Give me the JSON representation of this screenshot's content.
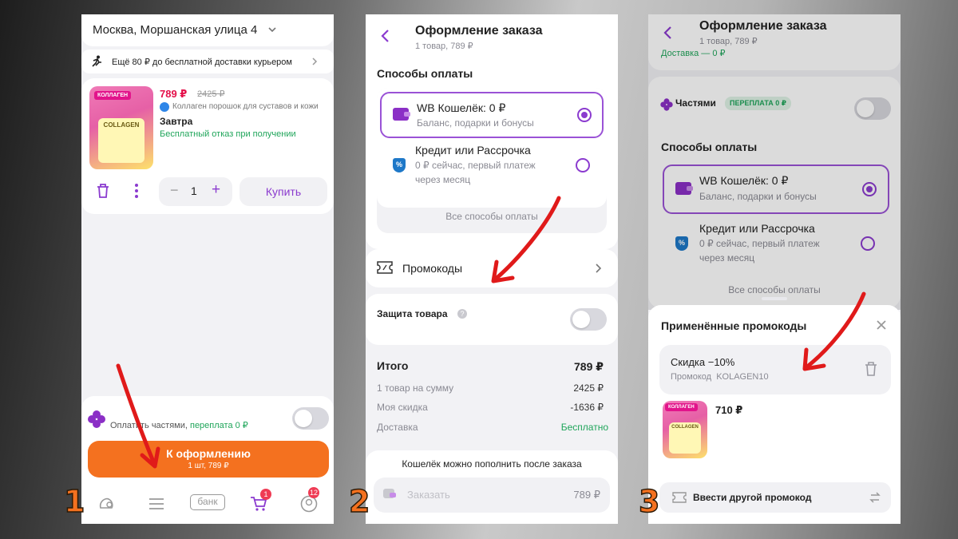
{
  "steps": [
    "1",
    "2",
    "3"
  ],
  "screen1": {
    "address": "Москва, Моршанская улица 4",
    "delivery_banner": "Ещё 80 ₽ до бесплатной доставки курьером",
    "product": {
      "price": "789 ₽",
      "old_price": "2425 ₽",
      "name": "Коллаген порошок для суставов и кожи",
      "delivery": "Завтра",
      "refusal": "Бесплатный отказ при получении",
      "image_label": "КОЛЛАГЕН",
      "image_text": "COLLAGEN"
    },
    "quantity": "1",
    "buy_label": "Купить",
    "installments": {
      "label_a": "Оплатить частями, ",
      "label_b": "переплата 0 ₽"
    },
    "checkout": {
      "label": "К оформлению",
      "sub": "1 шт,  789 ₽"
    },
    "nav": {
      "bank": "банк",
      "cart_badge": "1",
      "profile_badge": "12"
    }
  },
  "screen2": {
    "title": "Оформление заказа",
    "subtitle": "1 товар, 789 ₽",
    "payment_heading": "Способы оплаты",
    "wallet": {
      "title": "WB Кошелёк: 0 ₽",
      "sub": "Баланс, подарки и бонусы"
    },
    "credit": {
      "title": "Кредит или Рассрочка",
      "sub1": "0 ₽ сейчас, первый платеж",
      "sub2": "через месяц"
    },
    "all_methods": "Все способы оплаты",
    "promo": "Промокоды",
    "protection": "Защита товара",
    "totals": {
      "total_label": "Итого",
      "total_value": "789 ₽",
      "sum_label": "1 товар на сумму",
      "sum_value": "2425 ₽",
      "discount_label": "Моя скидка",
      "discount_value": "-1636 ₽",
      "delivery_label": "Доставка",
      "delivery_value": "Бесплатно"
    },
    "wallet_note": "Кошелёк можно пополнить после заказа",
    "order_label": "Заказать",
    "order_value": "789 ₽"
  },
  "screen3": {
    "title": "Оформление заказа",
    "subtitle": "1 товар, 789 ₽",
    "cut_text": "Доставка — 0 ₽",
    "parts_label": "Частями",
    "parts_badge": "ПЕРЕПЛАТА 0 ₽",
    "payment_heading": "Способы оплаты",
    "wallet": {
      "title": "WB Кошелёк: 0 ₽",
      "sub": "Баланс, подарки и бонусы"
    },
    "credit": {
      "title": "Кредит или Рассрочка",
      "sub1": "0 ₽ сейчас, первый платеж",
      "sub2": "через месяц"
    },
    "all_methods": "Все способы оплаты",
    "sheet": {
      "title": "Применённые промокоды",
      "promo_name": "Скидка −10%",
      "promo_label": "Промокод",
      "promo_code": "KOLAGEN10",
      "new_price": "710 ₽",
      "enter_other": "Ввести другой промокод"
    }
  },
  "colors": {
    "accent": "#8b3bcf",
    "orange": "#f4711f",
    "green": "#1fa55a",
    "price_red": "#e4104a",
    "arrow": "#e01a1a"
  }
}
